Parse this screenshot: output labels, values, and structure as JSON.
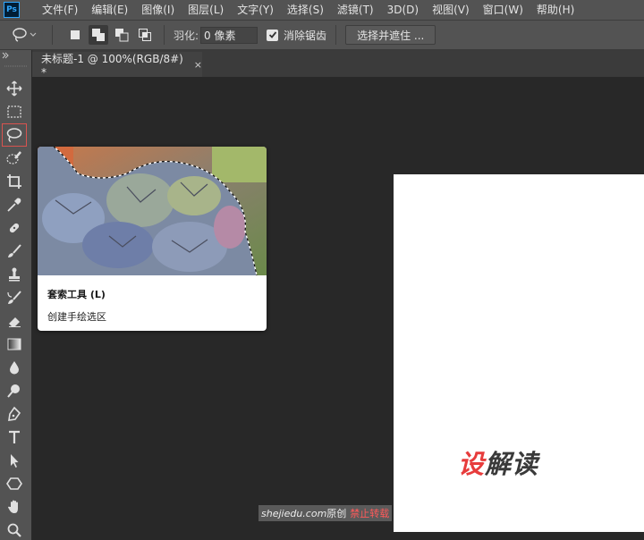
{
  "app": {
    "logo_text": "Ps"
  },
  "menu": {
    "items": [
      {
        "id": "file",
        "label": "文件(F)"
      },
      {
        "id": "edit",
        "label": "编辑(E)"
      },
      {
        "id": "image",
        "label": "图像(I)"
      },
      {
        "id": "layer",
        "label": "图层(L)"
      },
      {
        "id": "type",
        "label": "文字(Y)"
      },
      {
        "id": "select",
        "label": "选择(S)"
      },
      {
        "id": "filter",
        "label": "滤镜(T)"
      },
      {
        "id": "3d",
        "label": "3D(D)"
      },
      {
        "id": "view",
        "label": "视图(V)"
      },
      {
        "id": "window",
        "label": "窗口(W)"
      },
      {
        "id": "help",
        "label": "帮助(H)"
      }
    ]
  },
  "options": {
    "feather_label": "羽化:",
    "feather_value": "0 像素",
    "antialias_label": "消除锯齿",
    "antialias_checked": true,
    "select_mask_label": "选择并遮住 ..."
  },
  "toolbar": {
    "tools": [
      "move-icon",
      "marquee-icon",
      "lasso-icon",
      "quick-select-icon",
      "crop-icon",
      "eyedropper-icon",
      "healing-brush-icon",
      "brush-icon",
      "stamp-icon",
      "history-brush-icon",
      "eraser-icon",
      "gradient-icon",
      "blur-icon",
      "dodge-icon",
      "pen-icon",
      "type-icon",
      "path-select-icon",
      "shape-icon",
      "hand-icon",
      "zoom-icon"
    ],
    "active_tool": "lasso-icon"
  },
  "document": {
    "tab_title": "未标题-1 @ 100%(RGB/8#) *",
    "close_glyph": "×"
  },
  "tooltip": {
    "title": "套索工具 (L)",
    "description": "创建手绘选区"
  },
  "canvas": {
    "logo_part1": "设",
    "logo_part2": "解读"
  },
  "watermark": {
    "site": "shejiedu.com",
    "original": "原创",
    "notice": "禁止转载"
  },
  "colors": {
    "ui_panel": "#535353",
    "canvas_bg": "#282828",
    "active_tool_border": "#d9534f",
    "brand_red": "#e73c3c"
  }
}
